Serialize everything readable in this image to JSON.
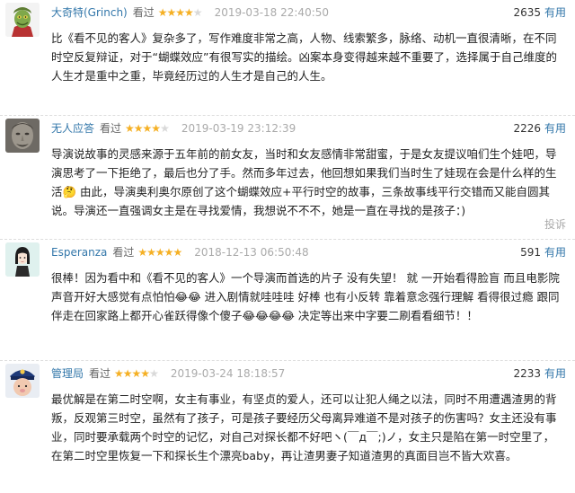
{
  "reviews": [
    {
      "author": "大奇特(Grinch)",
      "watched": "看过",
      "rating": 4,
      "time": "2019-03-18 22:40:50",
      "votes": "2635",
      "useful_label": "有用",
      "content": "比《看不见的客人》复杂多了，写作难度非常之高，人物、线索繁多，脉络、动机一直很清晰，在不同时空反复辩证，对于“蝴蝶效应”有很写实的描绘。凶案本身变得越来越不重要了，选择属于自己维度的人生才是重中之重，毕竟经历过的人生才是自己的人生。",
      "avatar": "grinch-avatar"
    },
    {
      "author": "无人应答",
      "watched": "看过",
      "rating": 4,
      "time": "2019-03-19 23:12:39",
      "votes": "2226",
      "useful_label": "有用",
      "content": "导演说故事的灵感来源于五年前的前女友，当时和女友感情非常甜蜜，于是女友提议咱们生个娃吧，导演思考了一下拒绝了，最后也分了手。然而多年过去，他回想如果我们当时生了娃现在会是什么样的生活🤔 由此，导演奥利奥尔原创了这个蝴蝶效应+平行时空的故事，三条故事线平行交错而又能自圆其说。导演还一直强调女主是在寻找爱情，我想说不不不，她是一直在寻找的是孩子：)",
      "report_label": "投诉",
      "avatar": "statue-avatar"
    },
    {
      "author": "Esperanza",
      "watched": "看过",
      "rating": 5,
      "time": "2018-12-13 06:50:48",
      "votes": "591",
      "useful_label": "有用",
      "content": "很棒！因为看中和《看不见的客人》一个导演而首选的片子 没有失望！ 就 一开始看得脸盲 而且电影院声音开好大感觉有点怕怕😂😂 进入剧情就哇哇哇 好棒 也有小反转 靠着意念强行理解 看得很过瘾 跟同伴走在回家路上都开心雀跃得像个傻子😂😂😂😂 决定等出来中字要二刷看看细节！！",
      "avatar": "girl-avatar"
    },
    {
      "author": "管理局",
      "watched": "看过",
      "rating": 4,
      "time": "2019-03-24 18:18:57",
      "votes": "2233",
      "useful_label": "有用",
      "content": "最优解是在第二时空啊，女主有事业，有坚贞的爱人，还可以让犯人绳之以法，同时不用遭遇渣男的背叛，反观第三时空，虽然有了孩子，可是孩子要经历父母离异难道不是对孩子的伤害吗？女主还没有事业，同时要承载两个时空的记忆，对自己对探长都不好吧ヽ(￣д￣;)ノ，女主只是陷在第一时空里了，在第二时空里恢复一下和探长生个漂亮baby，再让渣男妻子知道渣男的真面目岂不皆大欢喜。",
      "avatar": "police-avatar"
    }
  ]
}
